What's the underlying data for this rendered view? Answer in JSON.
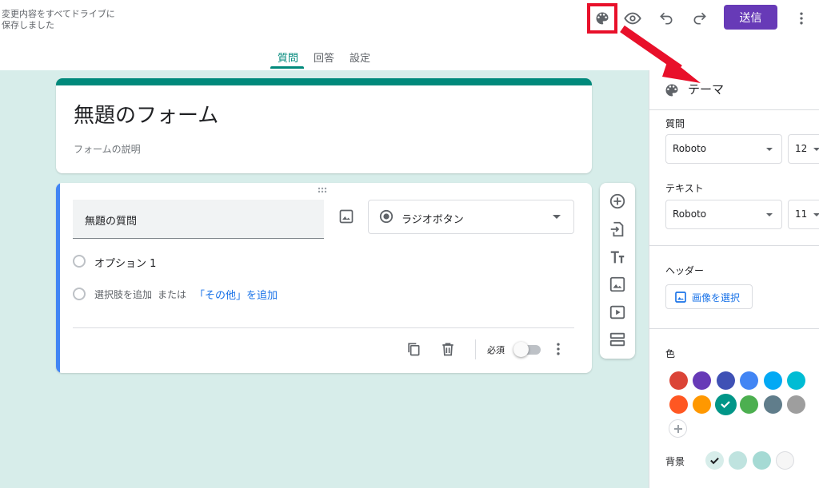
{
  "header": {
    "save_status_line1": "変更内容をすべてドライブに",
    "save_status_line2": "保存しました",
    "send_label": "送信",
    "icons": [
      "palette-icon",
      "eye-icon",
      "undo-icon",
      "redo-icon",
      "more-vert-icon"
    ]
  },
  "tabs": [
    {
      "label": "質問",
      "active": true
    },
    {
      "label": "回答",
      "active": false
    },
    {
      "label": "設定",
      "active": false
    }
  ],
  "form": {
    "title": "無題のフォーム",
    "description": "フォームの説明"
  },
  "question": {
    "title": "無題の質問",
    "type": "ラジオボタン",
    "options": [
      "オプション 1"
    ],
    "add_option": "選択肢を追加",
    "or": "または",
    "add_other": "「その他」を追加",
    "required_label": "必須",
    "required": false
  },
  "side_toolbar": [
    "add-question-icon",
    "import-icon",
    "title-text-icon",
    "image-icon",
    "video-icon",
    "section-icon"
  ],
  "theme_panel": {
    "title": "テーマ",
    "question_label": "質問",
    "question_font": "Roboto",
    "question_size": "12",
    "text_label": "テキスト",
    "text_font": "Roboto",
    "text_size": "11",
    "header_label": "ヘッダー",
    "select_image_label": "画像を選択",
    "color_label": "色",
    "colors": [
      "#db4437",
      "#673ab7",
      "#3f51b5",
      "#4285f4",
      "#03a9f4",
      "#00bcd4",
      "#ff5722",
      "#ff9800",
      "#009688",
      "#4caf50",
      "#607d8b",
      "#9e9e9e"
    ],
    "selected_color": "#009688",
    "background_label": "背景",
    "backgrounds": [
      "#d7edea",
      "#bfe3df",
      "#a5dad4",
      "#f6f6f6"
    ],
    "selected_background": "#d7edea"
  },
  "accent": {
    "teal": "#00897b",
    "purple": "#673ab7",
    "blue": "#4285f4",
    "annotation_red": "#e8102a"
  }
}
